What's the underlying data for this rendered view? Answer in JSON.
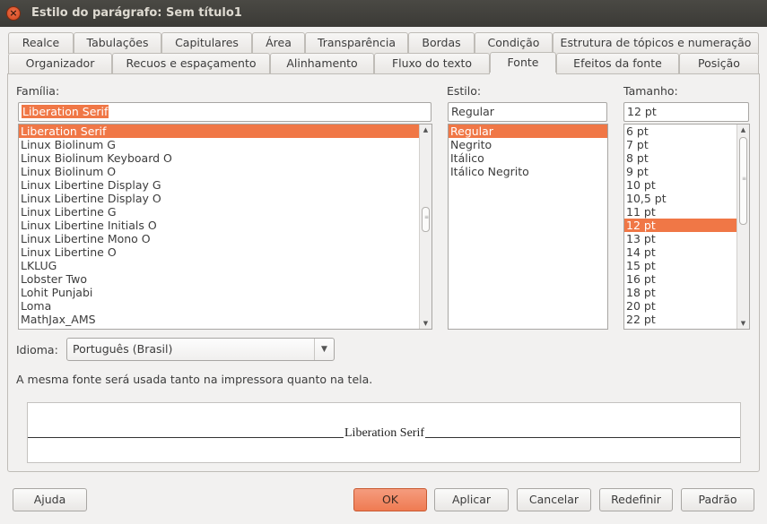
{
  "window": {
    "title": "Estilo do parágrafo: Sem título1",
    "close_glyph": "×"
  },
  "tabs_row1": [
    "Realce",
    "Tabulações",
    "Capitulares",
    "Área",
    "Transparência",
    "Bordas",
    "Condição",
    "Estrutura de tópicos e numeração"
  ],
  "tabs_row2": [
    "Organizador",
    "Recuos e espaçamento",
    "Alinhamento",
    "Fluxo do texto",
    "Fonte",
    "Efeitos da fonte",
    "Posição"
  ],
  "active_tab": "Fonte",
  "family": {
    "label": "Família:",
    "value": "Liberation Serif",
    "items": [
      "Liberation Serif",
      "Linux Biolinum G",
      "Linux Biolinum Keyboard O",
      "Linux Biolinum O",
      "Linux Libertine Display G",
      "Linux Libertine Display O",
      "Linux Libertine G",
      "Linux Libertine Initials O",
      "Linux Libertine Mono O",
      "Linux Libertine O",
      "LKLUG",
      "Lobster Two",
      "Lohit Punjabi",
      "Loma",
      "MathJax_AMS"
    ],
    "selected": "Liberation Serif"
  },
  "style": {
    "label": "Estilo:",
    "value": "Regular",
    "items": [
      "Regular",
      "Negrito",
      "Itálico",
      "Itálico Negrito"
    ],
    "selected": "Regular"
  },
  "size": {
    "label": "Tamanho:",
    "value": "12 pt",
    "items": [
      "6 pt",
      "7 pt",
      "8 pt",
      "9 pt",
      "10 pt",
      "10,5 pt",
      "11 pt",
      "12 pt",
      "13 pt",
      "14 pt",
      "15 pt",
      "16 pt",
      "18 pt",
      "20 pt",
      "22 pt"
    ],
    "selected": "12 pt"
  },
  "language": {
    "label": "Idioma:",
    "value": "Português (Brasil)"
  },
  "info_text": "A mesma fonte será usada tanto na impressora quanto na tela.",
  "preview_text": "Liberation Serif",
  "buttons": {
    "help": "Ajuda",
    "ok": "OK",
    "apply": "Aplicar",
    "cancel": "Cancelar",
    "reset": "Redefinir",
    "standard": "Padrão"
  },
  "colors": {
    "selection": "#f07746",
    "titlebar": "#3b3a36",
    "primary_button": "#ef7b52"
  }
}
